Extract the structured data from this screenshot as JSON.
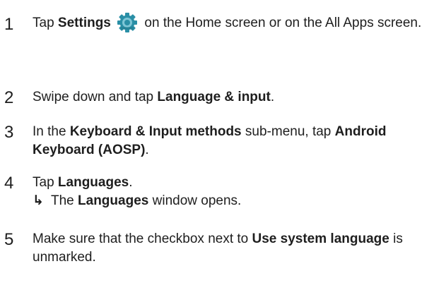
{
  "steps": [
    {
      "number": "1",
      "before": "Tap ",
      "bold1": "Settings",
      "icon": "settings-gear-icon",
      "after": " on the Home screen or on the All Apps screen."
    },
    {
      "number": "2",
      "before": "Swipe down and tap ",
      "bold1": "Language & input",
      "after": "."
    },
    {
      "number": "3",
      "before": "In the ",
      "bold1": "Keyboard & Input methods",
      "middle": " sub-menu, tap ",
      "bold2": "Android Keyboard (AOSP)",
      "after": "."
    },
    {
      "number": "4",
      "before": "Tap ",
      "bold1": "Languages",
      "after": ".",
      "result_arrow": "↳",
      "result_before": "The ",
      "result_bold": "Languages",
      "result_after": " window opens."
    },
    {
      "number": "5",
      "before": "Make sure that the checkbox next to ",
      "bold1": "Use system language",
      "after": " is unmarked."
    }
  ],
  "colors": {
    "text": "#1e1e1e",
    "icon_gear": "#2a8fa6"
  }
}
